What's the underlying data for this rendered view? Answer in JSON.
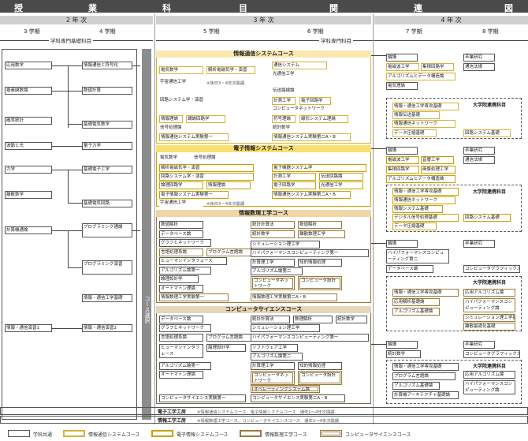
{
  "title_chars": [
    "授",
    "業",
    "科",
    "目",
    "関",
    "連",
    "図"
  ],
  "years": {
    "y2": "2 年 次",
    "y3": "3 年 次",
    "y4": "4 年 次"
  },
  "semesters": [
    "3 学期",
    "4 学期",
    "5 学期",
    "6 学期",
    "7 学期",
    "8 学期"
  ],
  "headers": {
    "basic": "学科専門基礎科目",
    "specialized": "学科専門科目"
  },
  "vertical_label": "コース選択",
  "left_y1": [
    "応用数学",
    "複素関数論",
    "確率統計",
    "波動と光",
    "力学",
    "離散数学",
    "計算機通論",
    "情報・通信演習1"
  ],
  "left_y2": [
    "情報通信と符号化",
    "数値計算",
    "基礎電気数学",
    "量子力学",
    "基礎電子工学",
    "基礎電気回路",
    "プログラミング通論",
    "プログラミング演習",
    "情報・通信工学基礎",
    "情報・通信演習2"
  ],
  "courses": {
    "c1": {
      "name": "情報通信システムコース",
      "y3": [
        "電気数学",
        "解析電磁気学・演習",
        "宇宙通信工学",
        "回路システム学・演習",
        "情報理論",
        "講論回路学",
        "信号処理論",
        "情報通信システム実験第一"
      ],
      "y3b": [
        "通信システム",
        "光通信工学",
        "伝送路線論",
        "計測工学",
        "電子回路学",
        "コンピュータネットワーク",
        "符号理論",
        "線形システム理論",
        "統計数学",
        "情報通信システム実験第二A・B"
      ],
      "note": "※後日3・4年次開講"
    },
    "c2": {
      "name": "電子情報システムコース",
      "y3": [
        "電気数学",
        "信号処理論",
        "解析電磁気学・演習",
        "回路システム学・演習",
        "論理回路学",
        "情報理論",
        "電子情報システム実験第一",
        "宇宙通信工学"
      ],
      "y3b": [
        "電子機器システム学",
        "計測工学",
        "伝送回路論",
        "電子回路学",
        "光通信工学",
        "情報通信システム実験第二A・B"
      ],
      "note": "※後日3・4年次開講"
    },
    "c3": {
      "name": "情報数理工学コース",
      "y3": [
        "数値解析",
        "データベース論",
        "グラフとネットワーク",
        "言語処理系論",
        "プログラム言語論",
        "ヒューマンインタフェース",
        "アルゴリズム論第一",
        "論理設計学",
        "オートマトン理論",
        "情報数理工学実験第一"
      ],
      "y3b": [
        "統計計算法",
        "数値解析",
        "統計数学",
        "離散数理工学",
        "シミュレーション理工学",
        "ハイパフォーマンスコンピューティング第一",
        "計算理工学",
        "知的情報処理",
        "アルゴリズム論第二",
        "コンピュータネットワーク",
        "コンピュータ設計",
        "情報数理工学実験第二A・B"
      ]
    },
    "c4": {
      "name": "コンピュータサイエンスコース",
      "y3": [
        "データベース論",
        "グラフとネットワーク",
        "言語処理系論",
        "プログラム言語論",
        "ヒューマンインタフェース",
        "論理設計学",
        "アルゴリズム論第一",
        "オートマトン理論",
        "コンピュータサイエンス実験第一"
      ],
      "y3b": [
        "統計計算法",
        "数理解析",
        "統計数学",
        "シミュレーション理工学",
        "ハイパフォーマンスコンピューティング第一",
        "ソフトウェア工学",
        "アルゴリズム論第二",
        "計算理工学",
        "知的情報処理",
        "コンピュータネットワーク",
        "コンピュータ設計",
        "オペレーティングシステム論",
        "コンピュータサイエンス実験第二A・B"
      ]
    }
  },
  "y4": {
    "g1": [
      "輪講",
      "卒業研究",
      "電磁波工学",
      "集積回路学",
      "通信法規",
      "アルゴリズムとデータ構造論",
      "電気理論"
    ],
    "g1_grad": {
      "title": "大学院連携科目",
      "items": [
        "情報・通信工学専攻基礎",
        "情報伝送基礎",
        "情報通信ネットワーク",
        "データ圧縮基礎",
        "回路システム基礎"
      ]
    },
    "g2": [
      "輪講",
      "卒業研究",
      "電磁波工学",
      "音響工学",
      "通信法規",
      "集積回路学",
      "画像処理工学",
      "アルゴリズムとデータ構造論"
    ],
    "g2_grad": {
      "title": "大学院連携科目",
      "items": [
        "情報・通信工学専攻基礎",
        "情報通信ネットワーク",
        "情報システム基礎",
        "デジタル信号処理基礎",
        "回路システム基礎",
        "データ圧縮基礎"
      ]
    },
    "g3": [
      "輪講",
      "卒業研究",
      "ハイパフォーマンスコンピューティング第二",
      "データベース論",
      "コンピュータグラフィックス"
    ],
    "g3_grad": {
      "title": "大学院連携科目",
      "items": [
        "情報・通信工学専攻基礎",
        "応用アルゴリズム論",
        "応用解析基礎論",
        "ハイパフォーマンスコンピューティング論",
        "アルゴリズム基礎論",
        "シミュレーション理工学基礎",
        "離散最適化基礎"
      ]
    },
    "g4": [
      "輪講",
      "卒業研究",
      "統計数学",
      "コンピュータグラフィックス"
    ],
    "g4_grad": {
      "title": "大学院連携科目",
      "items": [
        "情報・通信工学専攻基礎",
        "応用アルゴリズム論",
        "プログラム言語論",
        "ハイパフォーマンスコンピューティング論",
        "アルゴリズム基礎論",
        "計算機アーキテクチャ基礎論"
      ]
    }
  },
  "footer": {
    "r1_label": "電子工学工房",
    "r1_note": "※情報通信システムコース、電子情報システムコース　通年1～4年次開講",
    "r2_label": "情報工学工房",
    "r2_note": "※情報数理工学コース、コンピュータサイエンスコース　通年1～4年次開講"
  },
  "legend": [
    "学科共通",
    "情報通信システムコース",
    "電子情報システムコース",
    "情報数理工学コース",
    "コンピュータサイエンスコース"
  ],
  "colors": {
    "c1": "#d8b23a",
    "c2": "#c8a000",
    "c3": "#9a7a3a",
    "c4": "#7a6a4a",
    "band1": "#fbe7b0",
    "band2": "#fbe070",
    "band3": "#f0d6a6",
    "band4": "#e8d6b8"
  }
}
